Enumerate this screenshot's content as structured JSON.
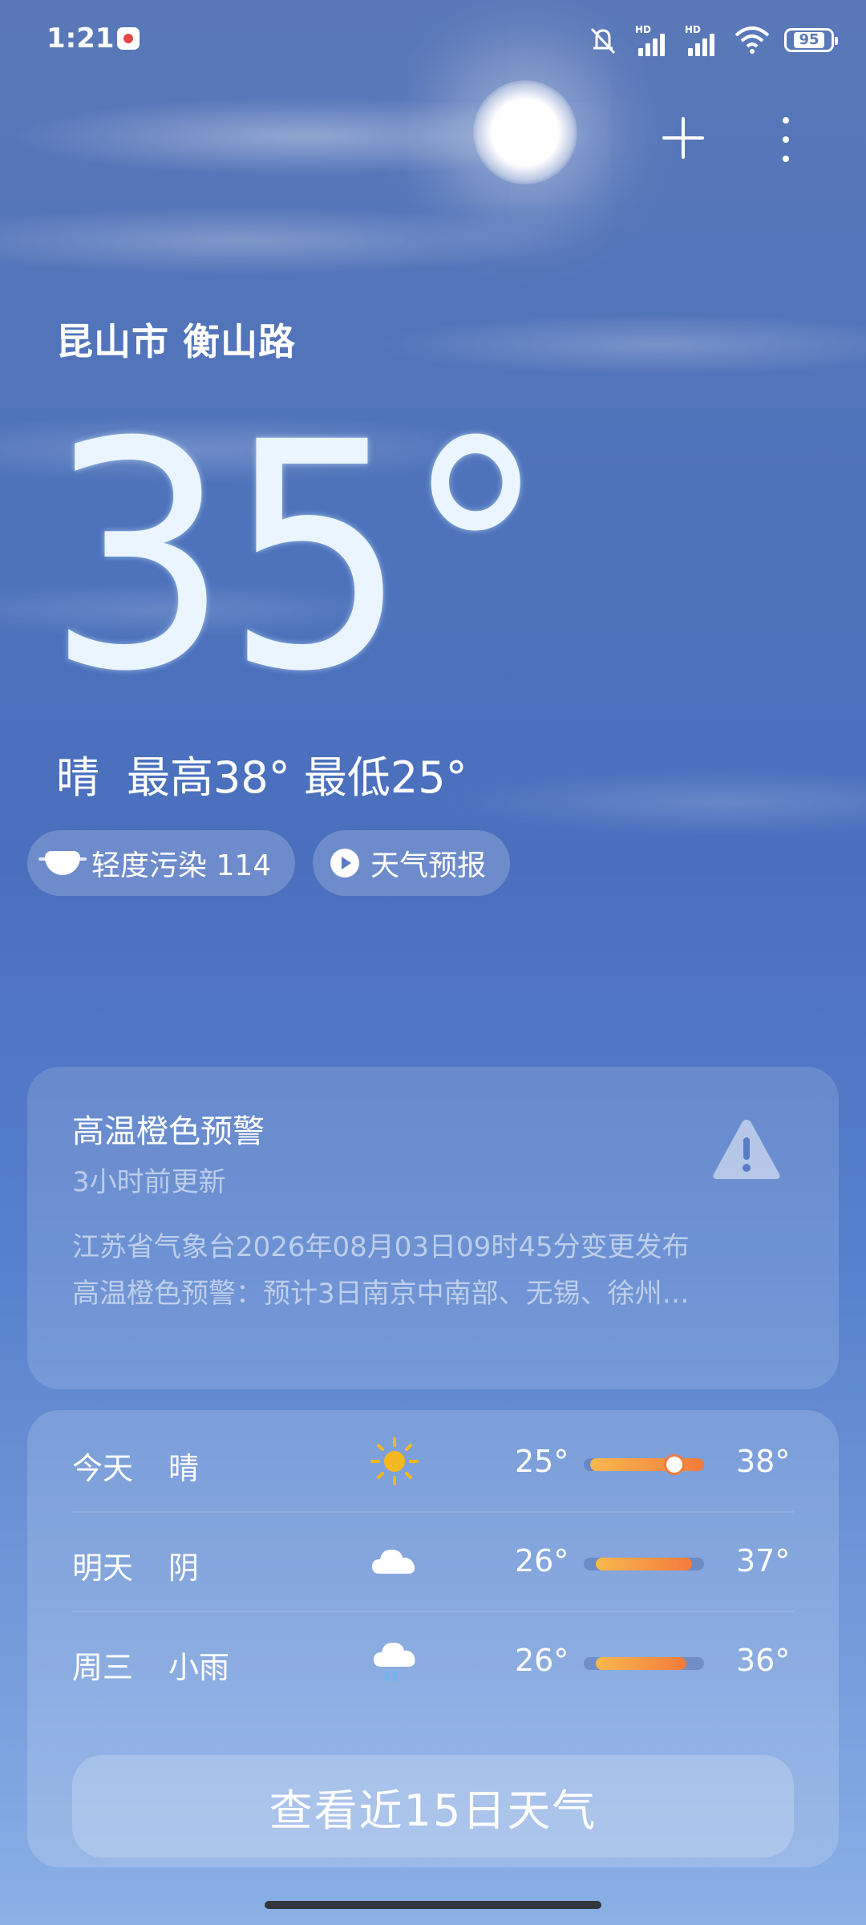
{
  "status_bar": {
    "time": "1:21",
    "network_tag_1": "HD",
    "network_tag_2": "HD",
    "battery": "95",
    "icons": [
      "app-notification-icon",
      "mute-icon",
      "signal-icon",
      "signal-icon",
      "wifi-icon",
      "battery-icon"
    ]
  },
  "header": {
    "location": "昆山市 衡山路"
  },
  "current": {
    "temperature": "35°",
    "condition": "晴",
    "high_low": "最高38° 最低25°"
  },
  "pills": {
    "aqi_label": "轻度污染 114",
    "forecast_label": "天气预报"
  },
  "alert": {
    "title": "高温橙色预警",
    "updated": "3小时前更新",
    "line1": "江苏省气象台2026年08月03日09时45分变更发布",
    "line2": "高温橙色预警：预计3日南京中南部、无锡、徐州…"
  },
  "forecast": {
    "days": [
      {
        "day": "今天",
        "condition": "晴",
        "icon": "sun-icon",
        "low": "25°",
        "high": "38°",
        "bar_start": 0.05,
        "bar_end": 1.0,
        "current_marker": 0.75
      },
      {
        "day": "明天",
        "condition": "阴",
        "icon": "cloud-icon",
        "low": "26°",
        "high": "37°",
        "bar_start": 0.1,
        "bar_end": 0.9
      },
      {
        "day": "周三",
        "condition": "小雨",
        "icon": "rain-cloud-icon",
        "low": "26°",
        "high": "36°",
        "bar_start": 0.1,
        "bar_end": 0.85
      }
    ],
    "button_label": "查看近15日天气"
  },
  "colors": {
    "bar_start": "#f8b84e",
    "bar_end": "#f47a3c",
    "sun_icon": "#f5b820"
  }
}
